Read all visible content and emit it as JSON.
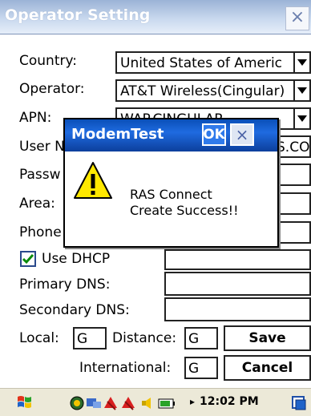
{
  "window": {
    "title": "Operator Setting",
    "close_icon": "close-icon"
  },
  "form": {
    "country_label": "Country:",
    "country_value": "United States of Americ",
    "operator_label": "Operator:",
    "operator_value": "AT&T Wireless(Cingular)",
    "apn_label": "APN:",
    "apn_value": "WAP.CINGULAR",
    "username_label": "User N",
    "username_value": "S.COM",
    "password_label": "Passw",
    "area_label": "Area:",
    "phone_label": "Phone",
    "dhcp_label": "Use DHCP",
    "dhcp_checked": true,
    "primary_dns_label": "Primary DNS:",
    "primary_dns_value": "",
    "secondary_dns_label": "Secondary DNS:",
    "secondary_dns_value": "",
    "local_label": "Local:",
    "local_value": "G",
    "distance_label": "Distance:",
    "distance_value": "G",
    "international_label": "International:",
    "international_value": "G",
    "save_label": "Save",
    "cancel_label": "Cancel"
  },
  "dialog": {
    "title": "ModemTest",
    "ok_label": "OK",
    "close_label": "×",
    "icon": "warning-icon",
    "message_line1": "RAS Connect",
    "message_line2": "Create Success!!"
  },
  "taskbar": {
    "time": "12:02 PM",
    "icons": [
      "start-windows-icon",
      "network-icon",
      "connection-icon",
      "signal-red-icon",
      "signal-red-icon-2",
      "volume-icon",
      "battery-icon",
      "keyboard-icon"
    ]
  }
}
